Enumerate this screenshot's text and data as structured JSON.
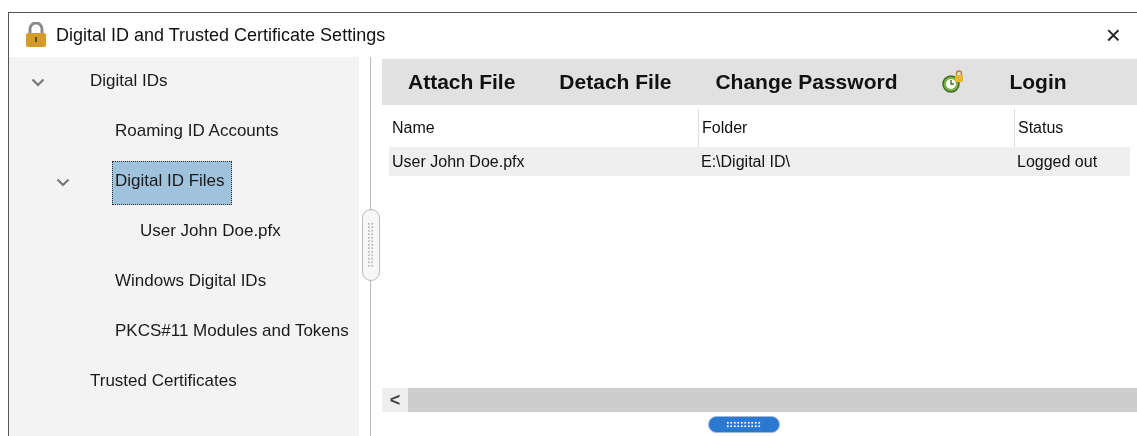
{
  "window": {
    "title": "Digital ID and Trusted Certificate Settings",
    "close": "×"
  },
  "sidebar": {
    "items": [
      {
        "label": "Digital IDs",
        "expanded": true,
        "selected": false,
        "children": [
          {
            "label": "Roaming ID Accounts",
            "selected": false
          },
          {
            "label": "Digital ID Files",
            "expanded": true,
            "selected": true,
            "children": [
              {
                "label": "User John Doe.pfx",
                "selected": false
              }
            ]
          },
          {
            "label": "Windows Digital IDs",
            "selected": false
          },
          {
            "label": "PKCS#11 Modules and Tokens",
            "selected": false
          }
        ]
      },
      {
        "label": "Trusted Certificates",
        "selected": false
      }
    ]
  },
  "toolbar": [
    {
      "kind": "text",
      "label": "Attach File"
    },
    {
      "kind": "text",
      "label": "Detach File"
    },
    {
      "kind": "text",
      "label": "Change Password"
    },
    {
      "kind": "icon"
    },
    {
      "kind": "text",
      "label": "Login"
    }
  ],
  "table": {
    "columns": [
      "Name",
      "Folder",
      "Status"
    ],
    "rows": [
      {
        "cells": [
          "User John Doe.pfx",
          "E:\\Digital ID\\",
          "Logged out"
        ],
        "selected": false
      }
    ]
  },
  "scrollbar": {
    "left": "<"
  }
}
